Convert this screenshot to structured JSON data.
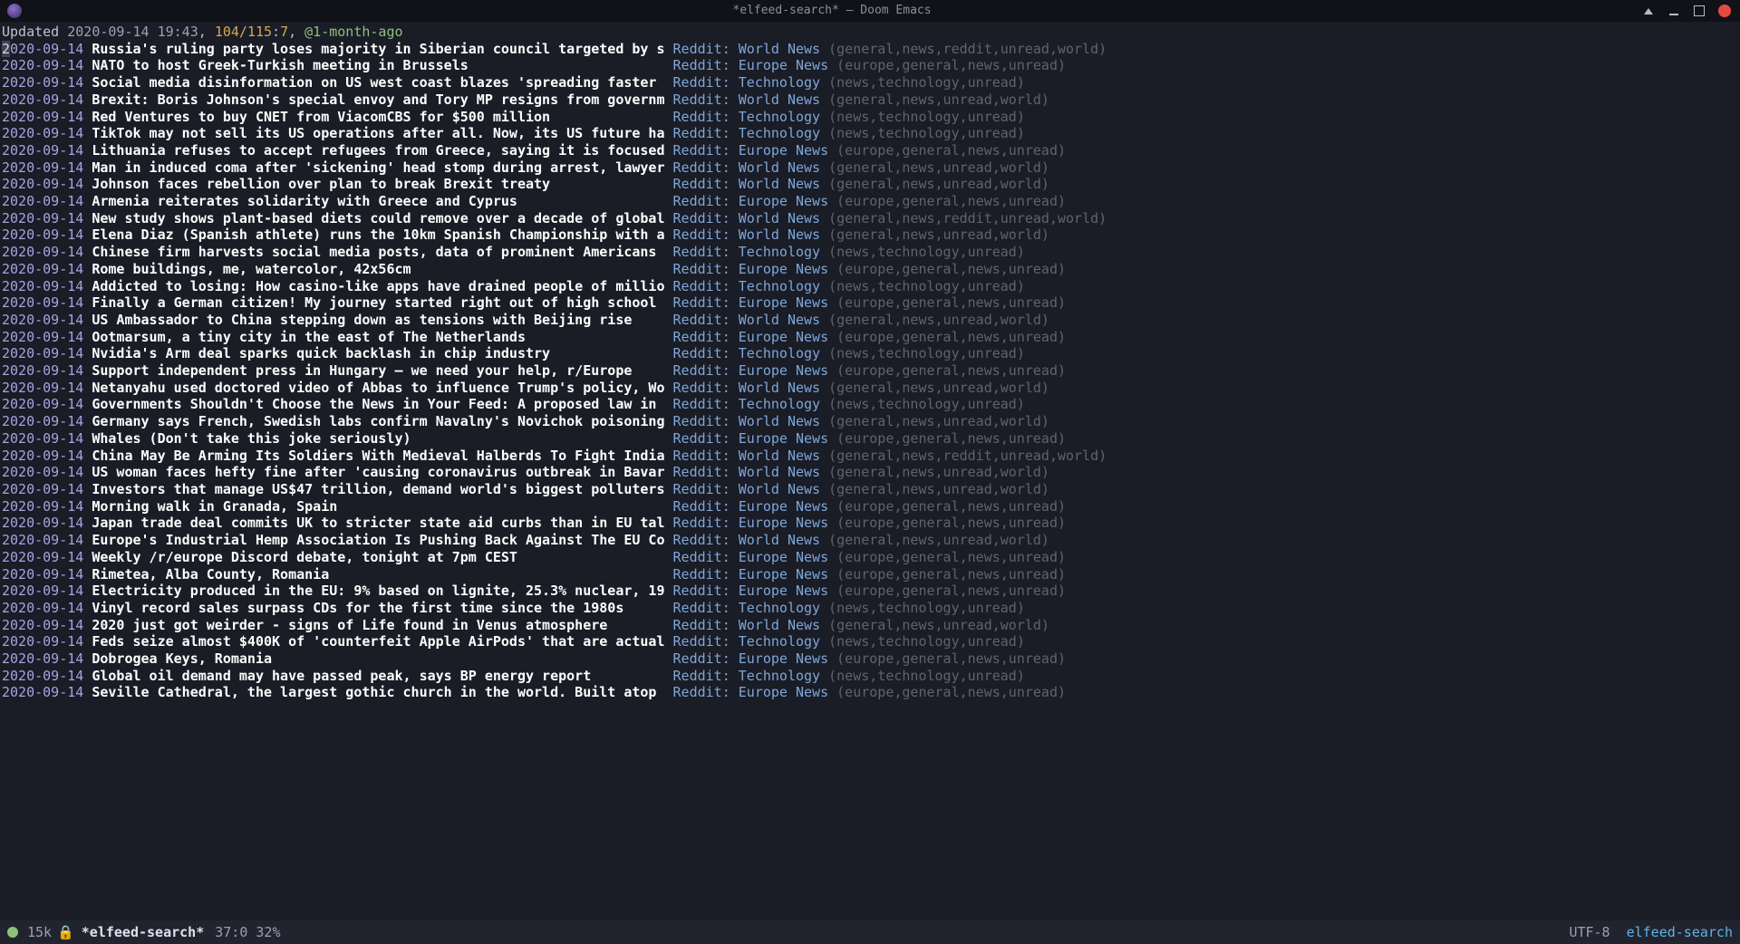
{
  "window": {
    "title": "*elfeed-search* – Doom Emacs"
  },
  "header": {
    "prefix": "Updated ",
    "timestamp": "2020-09-14 19:43",
    "shown_total": "104/115",
    "offset": "7",
    "filter": "@1-month-ago"
  },
  "feeds": {
    "world": {
      "name": "Reddit: World News",
      "tags": "(general,news,reddit,unread,world)"
    },
    "world2": {
      "name": "Reddit: World News",
      "tags": "(general,news,unread,world)"
    },
    "europe": {
      "name": "Reddit: Europe News",
      "tags": "(europe,general,news,unread)"
    },
    "tech": {
      "name": "Reddit: Technology",
      "tags": "(news,technology,unread)"
    }
  },
  "entries": [
    {
      "date": "2020-09-14",
      "title": "Russia's ruling party loses majority in Siberian council targeted by s",
      "feed": "world"
    },
    {
      "date": "2020-09-14",
      "title": "NATO to host Greek-Turkish meeting in Brussels",
      "feed": "europe"
    },
    {
      "date": "2020-09-14",
      "title": "Social media disinformation on US west coast blazes 'spreading faster",
      "feed": "tech"
    },
    {
      "date": "2020-09-14",
      "title": "Brexit: Boris Johnson's special envoy and Tory MP resigns from governm",
      "feed": "world2"
    },
    {
      "date": "2020-09-14",
      "title": "Red Ventures to buy CNET from ViacomCBS for $500 million",
      "feed": "tech"
    },
    {
      "date": "2020-09-14",
      "title": "TikTok may not sell its US operations after all. Now, its US future ha",
      "feed": "tech"
    },
    {
      "date": "2020-09-14",
      "title": "Lithuania refuses to accept refugees from Greece, saying it is focused",
      "feed": "europe"
    },
    {
      "date": "2020-09-14",
      "title": "Man in induced coma after 'sickening' head stomp during arrest, lawyer",
      "feed": "world2"
    },
    {
      "date": "2020-09-14",
      "title": "Johnson faces rebellion over plan to break Brexit treaty",
      "feed": "world2"
    },
    {
      "date": "2020-09-14",
      "title": "Armenia reiterates solidarity with Greece and Cyprus",
      "feed": "europe"
    },
    {
      "date": "2020-09-14",
      "title": "New study shows plant-based diets could remove over a decade of global",
      "feed": "world"
    },
    {
      "date": "2020-09-14",
      "title": "Elena Diaz (Spanish athlete) runs the 10km Spanish Championship with a",
      "feed": "world2"
    },
    {
      "date": "2020-09-14",
      "title": "Chinese firm harvests social media posts, data of prominent Americans",
      "feed": "tech"
    },
    {
      "date": "2020-09-14",
      "title": "Rome buildings, me, watercolor, 42x56cm",
      "feed": "europe"
    },
    {
      "date": "2020-09-14",
      "title": "Addicted to losing: How casino-like apps have drained people of millio",
      "feed": "tech"
    },
    {
      "date": "2020-09-14",
      "title": "Finally a German citizen! My journey started right out of high school",
      "feed": "europe"
    },
    {
      "date": "2020-09-14",
      "title": "US Ambassador to China stepping down as tensions with Beijing rise",
      "feed": "world2"
    },
    {
      "date": "2020-09-14",
      "title": "Ootmarsum, a tiny city in the east of The Netherlands",
      "feed": "europe"
    },
    {
      "date": "2020-09-14",
      "title": "Nvidia's Arm deal sparks quick backlash in chip industry",
      "feed": "tech"
    },
    {
      "date": "2020-09-14",
      "title": "Support independent press in Hungary – we need your help, r/Europe",
      "feed": "europe"
    },
    {
      "date": "2020-09-14",
      "title": "Netanyahu used doctored video of Abbas to influence Trump's policy, Wo",
      "feed": "world2"
    },
    {
      "date": "2020-09-14",
      "title": "Governments Shouldn't Choose the News in Your Feed: A proposed law in",
      "feed": "tech"
    },
    {
      "date": "2020-09-14",
      "title": "Germany says French, Swedish labs confirm Navalny's Novichok poisoning",
      "feed": "world2"
    },
    {
      "date": "2020-09-14",
      "title": "Whales (Don't take this joke seriously)",
      "feed": "europe"
    },
    {
      "date": "2020-09-14",
      "title": "China May Be Arming Its Soldiers With Medieval Halberds To Fight India",
      "feed": "world"
    },
    {
      "date": "2020-09-14",
      "title": "US woman faces hefty fine after 'causing coronavirus outbreak in Bavar",
      "feed": "world2"
    },
    {
      "date": "2020-09-14",
      "title": "Investors that manage US$47 trillion, demand world's biggest polluters",
      "feed": "world2"
    },
    {
      "date": "2020-09-14",
      "title": "Morning walk in Granada, Spain",
      "feed": "europe"
    },
    {
      "date": "2020-09-14",
      "title": "Japan trade deal commits UK to stricter state aid curbs than in EU tal",
      "feed": "europe"
    },
    {
      "date": "2020-09-14",
      "title": "Europe's Industrial Hemp Association Is Pushing Back Against The EU Co",
      "feed": "world2"
    },
    {
      "date": "2020-09-14",
      "title": "Weekly /r/europe Discord debate, tonight at 7pm CEST",
      "feed": "europe"
    },
    {
      "date": "2020-09-14",
      "title": "Rimetea, Alba County, Romania",
      "feed": "europe"
    },
    {
      "date": "2020-09-14",
      "title": "Electricity produced in the EU: 9% based on lignite, 25.3% nuclear, 19",
      "feed": "europe"
    },
    {
      "date": "2020-09-14",
      "title": "Vinyl record sales surpass CDs for the first time since the 1980s",
      "feed": "tech"
    },
    {
      "date": "2020-09-14",
      "title": "2020 just got weirder - signs of Life found in Venus atmosphere",
      "feed": "world2"
    },
    {
      "date": "2020-09-14",
      "title": "Feds seize almost $400K of 'counterfeit Apple AirPods' that are actual",
      "feed": "tech"
    },
    {
      "date": "2020-09-14",
      "title": "Dobrogea Keys, Romania",
      "feed": "europe"
    },
    {
      "date": "2020-09-14",
      "title": "Global oil demand may have passed peak, says BP energy report",
      "feed": "tech"
    },
    {
      "date": "2020-09-14",
      "title": "Seville Cathedral, the largest gothic church in the world. Built atop",
      "feed": "europe"
    }
  ],
  "layout": {
    "title_width": 70
  },
  "modeline": {
    "size": "15k",
    "lock_icon": "🔒",
    "buffer": "*elfeed-search*",
    "position": "37:0 32%",
    "encoding": "UTF-8",
    "mode": "elfeed-search"
  }
}
